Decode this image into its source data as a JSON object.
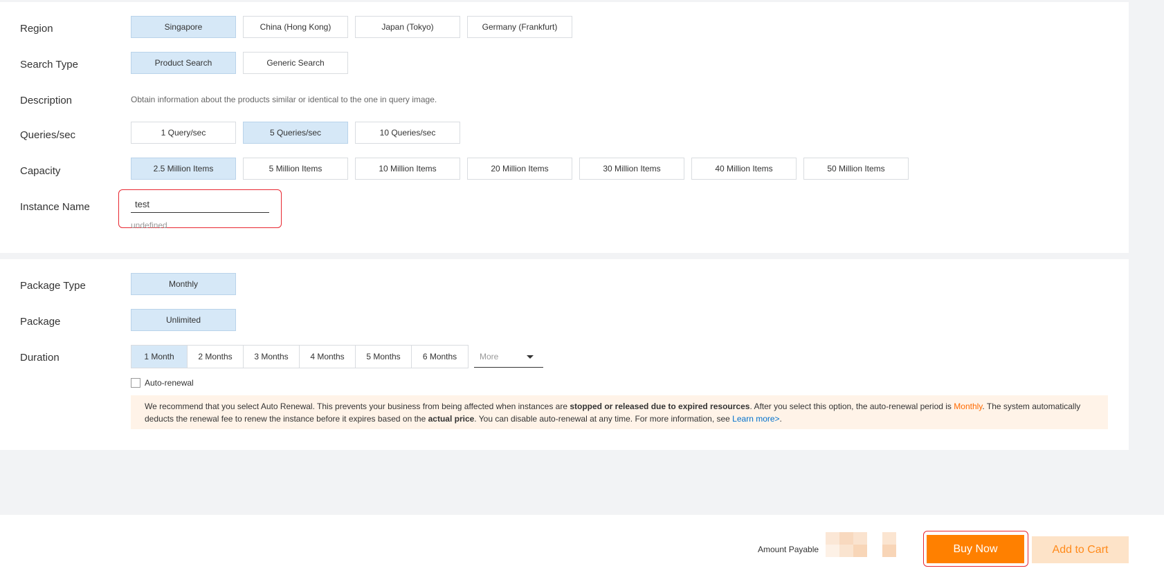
{
  "config": {
    "region": {
      "label": "Region",
      "options": [
        "Singapore",
        "China (Hong Kong)",
        "Japan (Tokyo)",
        "Germany (Frankfurt)"
      ]
    },
    "search_type": {
      "label": "Search Type",
      "options": [
        "Product Search",
        "Generic Search"
      ]
    },
    "description": {
      "label": "Description",
      "text": "Obtain information about the products similar or identical to the one in query image."
    },
    "qps": {
      "label": "Queries/sec",
      "options": [
        "1 Query/sec",
        "5 Queries/sec",
        "10 Queries/sec"
      ]
    },
    "capacity": {
      "label": "Capacity",
      "options": [
        "2.5 Million Items",
        "5 Million Items",
        "10 Million Items",
        "20 Million Items",
        "30 Million Items",
        "40 Million Items",
        "50 Million Items"
      ]
    },
    "instance_name": {
      "label": "Instance Name",
      "value": "test",
      "hint": "undefined"
    }
  },
  "billing": {
    "package_type": {
      "label": "Package Type",
      "options": [
        "Monthly"
      ]
    },
    "package": {
      "label": "Package",
      "options": [
        "Unlimited"
      ]
    },
    "duration": {
      "label": "Duration",
      "options": [
        "1 Month",
        "2 Months",
        "3 Months",
        "4 Months",
        "5 Months",
        "6 Months"
      ],
      "more_placeholder": "More"
    },
    "auto_renewal": {
      "label": "Auto-renewal",
      "checked": false
    },
    "notice": {
      "part1": "We recommend that you select Auto Renewal. This prevents your business from being affected when instances are ",
      "bold1": "stopped or released due to expired resources",
      "part2": ". After you select this option, the auto-renewal period is ",
      "period": "Monthly",
      "part3": ". The system automatically deducts the renewal fee to renew the instance before it expires based on the ",
      "bold2": "actual price",
      "part4": ". You can disable auto-renewal at any time. For more information, see ",
      "link": "Learn more>",
      "part5": "."
    }
  },
  "footer": {
    "amount_label": "Amount Payable",
    "buy_now": "Buy Now",
    "add_to_cart": "Add to Cart"
  },
  "colors": {
    "selected_bg": "#d6e8f7",
    "accent_orange": "#ff8000",
    "highlight_red": "#e8262f",
    "link_blue": "#0070cc"
  }
}
